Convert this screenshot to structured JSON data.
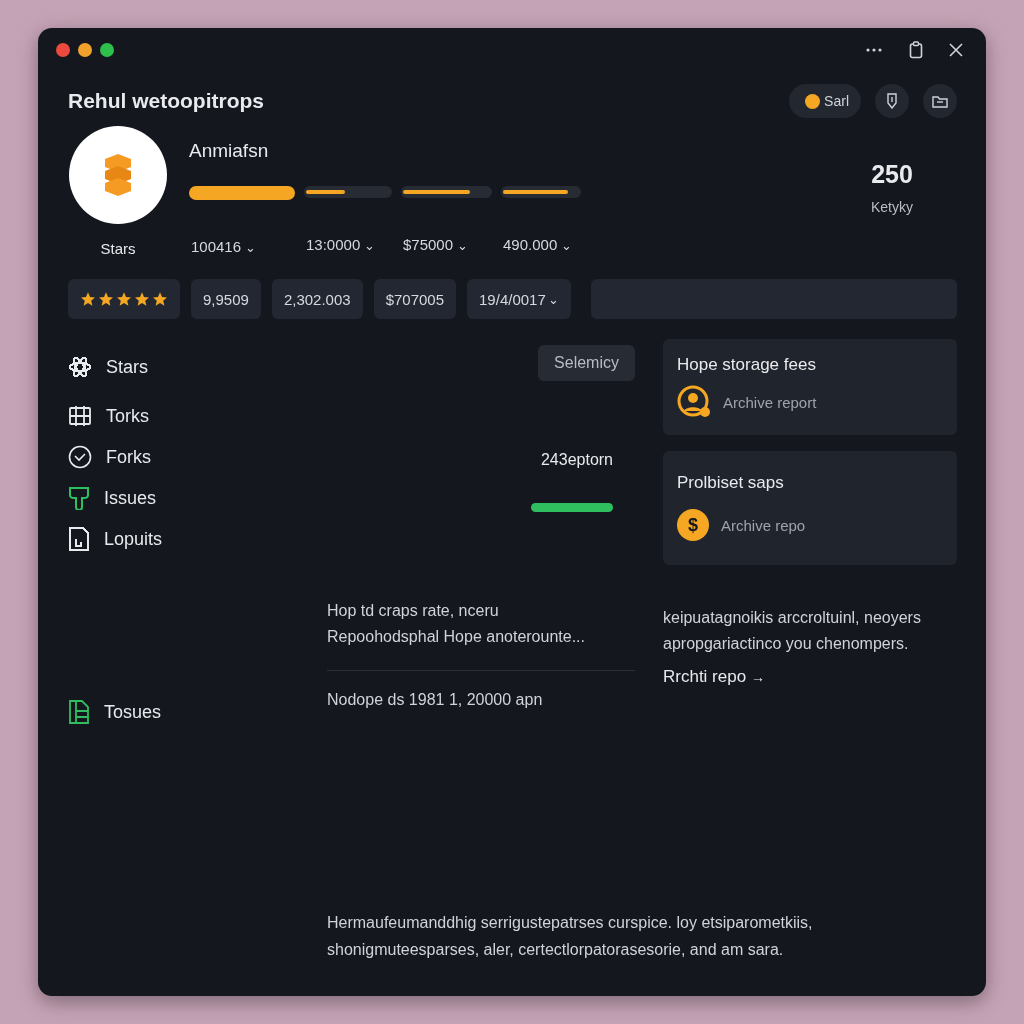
{
  "window": {
    "title": "Rehul wetoopitrops",
    "controls": [
      {
        "color": "#ec4a3f"
      },
      {
        "color": "#f0a12c"
      },
      {
        "color": "#2fbf4d"
      }
    ]
  },
  "header_actions": {
    "status": {
      "label": "Sarl"
    }
  },
  "profile": {
    "name": "Anmiafsn",
    "avatar_label": "Stars",
    "bars": [
      {
        "value": "100416",
        "chevron": "⌄"
      },
      {
        "level": 0.47,
        "value": "13:0000",
        "chevron": "⌄"
      },
      {
        "level": 0.77,
        "value": "$75000",
        "chevron": "⌄"
      },
      {
        "level": 0.85,
        "value": "490.000",
        "chevron": "⌄"
      }
    ],
    "stat": {
      "value": "250",
      "label": "Ketyky"
    }
  },
  "chips": [
    {
      "kind": "stars",
      "stars": 5
    },
    {
      "kind": "text",
      "value": "9,9509"
    },
    {
      "kind": "text",
      "value": "2,302.003"
    },
    {
      "kind": "text",
      "value": "$707005"
    },
    {
      "kind": "dropdown",
      "value": "19/4/0017",
      "chevron": "⌄"
    },
    {
      "kind": "field"
    }
  ],
  "sidebar": {
    "items": [
      {
        "label": "Stars",
        "color": "#e8eaee"
      },
      {
        "label": "Torks",
        "color": "#e8eaee"
      },
      {
        "label": "Forks",
        "color": "#e8eaee"
      },
      {
        "label": "Issues",
        "color": "#2fbf5f"
      },
      {
        "label": "Lopuits",
        "color": "#e8eaee"
      },
      {
        "label": "Tosues",
        "color": "#2fbf5f"
      }
    ]
  },
  "center": {
    "button": "Selemicy",
    "metric": "243eptorn",
    "summary": [
      "Hop td craps rate, nceru",
      "Repoohodsphal Hope anoterounte..."
    ],
    "date": "Nodope ds 1981 1, 20000 apn"
  },
  "cards": [
    {
      "title": "Hope storage fees",
      "kind": "person",
      "action": "Archive report"
    },
    {
      "title": "Prolbiset saps",
      "kind": "glyph",
      "glyph": "$",
      "action": "Archive repo"
    }
  ],
  "note": {
    "text": "keipuatagnoikis arccroltuinl, neoyers apropgariactinco you chenompers.",
    "link": "Rrchti repo",
    "arrow": "→"
  },
  "footer_text": "Hermaufeumanddhig serrigustepatrses curspice. loy etsiparometkiis, shonigmuteesparses, aler, certectlorpatorasesorie, and am sara."
}
